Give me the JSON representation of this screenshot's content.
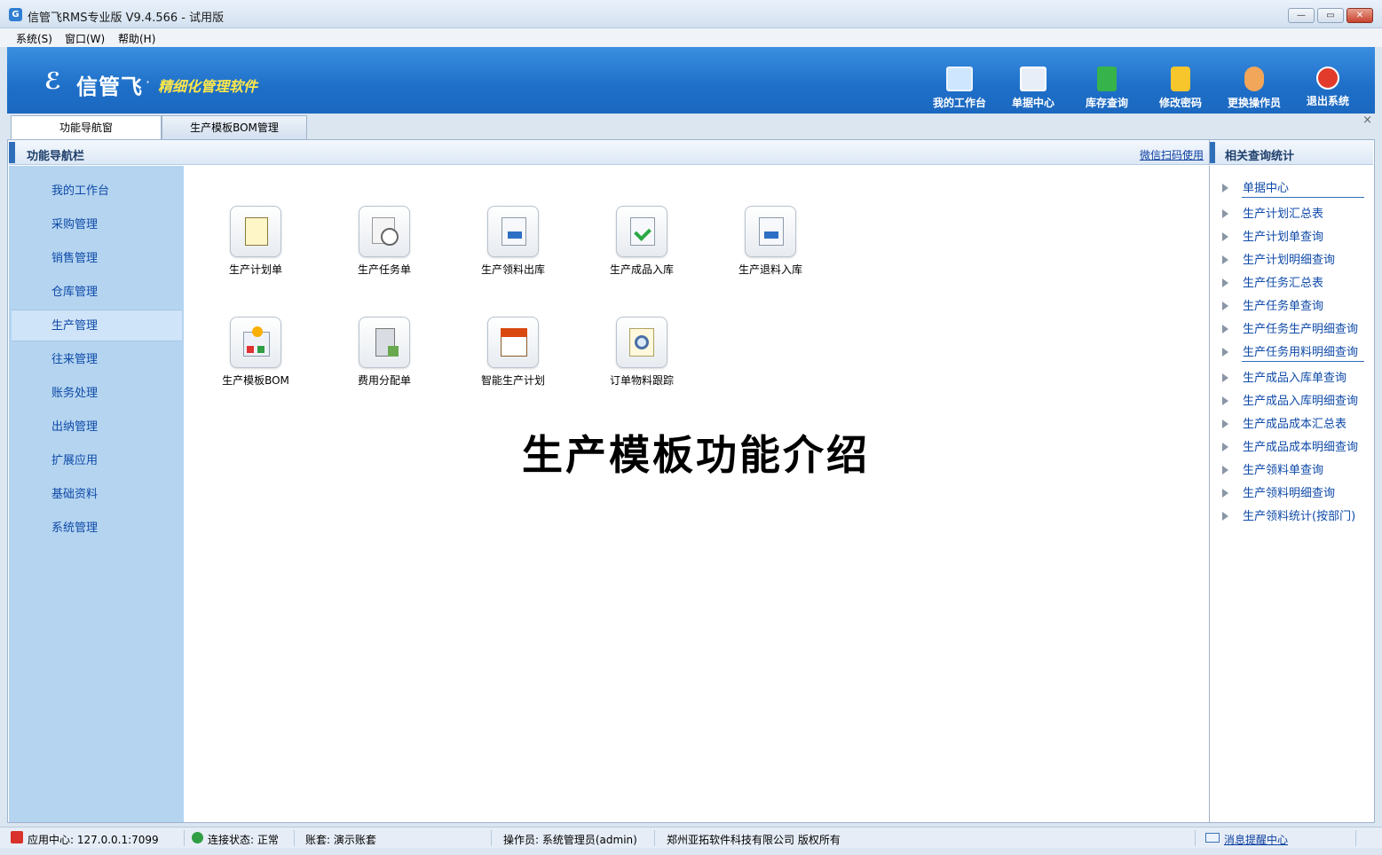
{
  "window": {
    "title": "信管飞RMS专业版 V9.4.566 - 试用版",
    "app_icon_glyph": "G",
    "minimize_glyph": "—",
    "maximize_glyph": "▭",
    "close_glyph": "✕"
  },
  "menu": {
    "system": "系统(S)",
    "window": "窗口(W)",
    "help": "帮助(H)"
  },
  "banner": {
    "logo_mark": "ℰ",
    "logo_text": "信管飞",
    "logo_dot": "·",
    "slogan": "精细化管理软件",
    "tools": [
      {
        "label": "我的工作台",
        "icon": "monitor-icon",
        "color": "#cfe6ff"
      },
      {
        "label": "单据中心",
        "icon": "document-list-icon",
        "color": "#e8eef7"
      },
      {
        "label": "库存查询",
        "icon": "inventory-book-icon",
        "color": "#36b34a"
      },
      {
        "label": "修改密码",
        "icon": "lock-icon",
        "color": "#f7c62c"
      },
      {
        "label": "更换操作员",
        "icon": "user-icon",
        "color": "#f2a65a"
      },
      {
        "label": "退出系统",
        "icon": "exit-icon",
        "color": "#e23b2c"
      }
    ]
  },
  "tabs": {
    "nav": "功能导航窗",
    "bom": "生产模板BOM管理",
    "close_glyph": "×"
  },
  "nav_panel": {
    "title": "功能导航栏",
    "wechat_link": "微信扫码使用"
  },
  "sidebar": {
    "items": [
      {
        "label": "我的工作台"
      },
      {
        "label": "采购管理"
      },
      {
        "label": "销售管理"
      },
      {
        "label": "仓库管理"
      },
      {
        "label": "生产管理"
      },
      {
        "label": "往来管理"
      },
      {
        "label": "账务处理"
      },
      {
        "label": "出纳管理"
      },
      {
        "label": "扩展应用"
      },
      {
        "label": "基础资料"
      },
      {
        "label": "系统管理"
      }
    ],
    "active": "生产管理"
  },
  "functions": [
    {
      "label": "生产计划单",
      "icon": "notepad-icon"
    },
    {
      "label": "生产任务单",
      "icon": "clock-document-icon"
    },
    {
      "label": "生产领料出库",
      "icon": "arrow-out-document-icon"
    },
    {
      "label": "生产成品入库",
      "icon": "check-document-icon"
    },
    {
      "label": "生产退料入库",
      "icon": "return-document-icon"
    },
    {
      "label": "生产模板BOM",
      "icon": "bom-template-icon"
    },
    {
      "label": "费用分配单",
      "icon": "calculator-icon"
    },
    {
      "label": "智能生产计划",
      "icon": "calendar-icon"
    },
    {
      "label": "订单物料跟踪",
      "icon": "magnifier-icon"
    }
  ],
  "intro_title": "生产模板功能介绍",
  "right_panel": {
    "title": "相关查询统计",
    "links": [
      "单据中心",
      "生产计划汇总表",
      "生产计划单查询",
      "生产计划明细查询",
      "生产任务汇总表",
      "生产任务单查询",
      "生产任务生产明细查询",
      "生产任务用料明细查询",
      "生产成品入库单查询",
      "生产成品入库明细查询",
      "生产成品成本汇总表",
      "生产成品成本明细查询",
      "生产领料单查询",
      "生产领料明细查询",
      "生产领料统计(按部门)"
    ]
  },
  "status": {
    "app_center": "应用中心: 127.0.0.1:7099",
    "connection": "连接状态: 正常",
    "account": "账套: 演示账套",
    "operator": "操作员: 系统管理员(admin)",
    "copyright": "郑州亚拓软件科技有限公司 版权所有",
    "message_center": "消息提醒中心"
  }
}
